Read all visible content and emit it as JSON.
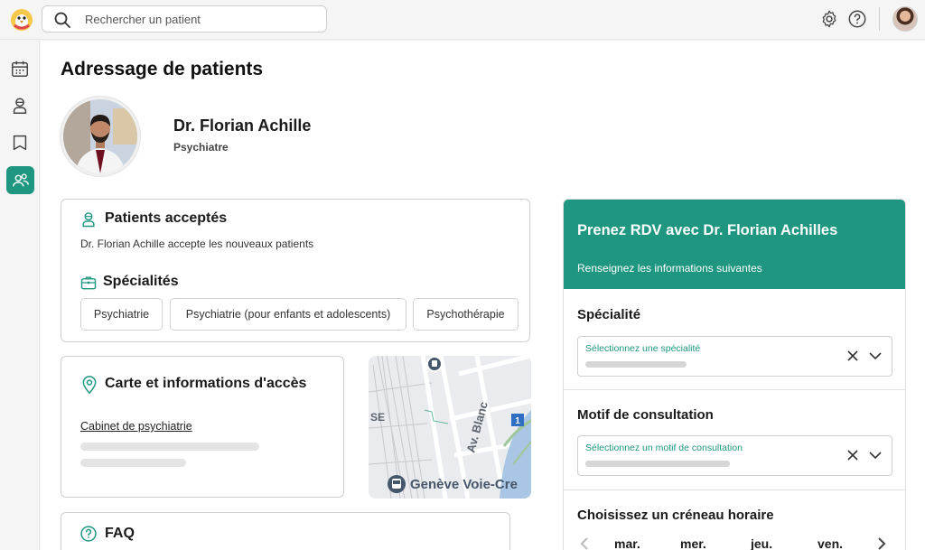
{
  "app": {
    "logo_icon": "penguin-logo",
    "accent": "#1e9680"
  },
  "search": {
    "placeholder": "Rechercher un patient"
  },
  "topbar": {
    "icons": [
      "gear-icon",
      "help-icon"
    ]
  },
  "sidebar": {
    "items": [
      {
        "icon": "calendar-icon",
        "active": false
      },
      {
        "icon": "patient-icon",
        "active": false
      },
      {
        "icon": "bookmark-icon",
        "active": false
      },
      {
        "icon": "referral-users-icon",
        "active": true
      }
    ]
  },
  "page": {
    "title": "Adressage de patients"
  },
  "doctor": {
    "name": "Dr. Florian Achille",
    "role": "Psychiatre"
  },
  "accepted": {
    "title": "Patients acceptés",
    "text": "Dr. Florian Achille accepte les nouveaux patients",
    "specialties_title": "Spécialités",
    "specialties": [
      "Psychiatrie",
      "Psychiatrie (pour enfants et adolescents)",
      "Psychothérapie"
    ]
  },
  "access": {
    "title": "Carte et informations d'accès",
    "link": "Cabinet de psychiatrie"
  },
  "map": {
    "street_label": "Av. Blanc",
    "station_label": "Genève Voie-Cre",
    "edge_label": "SE",
    "route_badge": "1"
  },
  "faq": {
    "title": "FAQ"
  },
  "booking": {
    "title": "Prenez RDV avec Dr. Florian Achilles",
    "subtitle": "Renseignez les informations suivantes",
    "specialty_title": "Spécialité",
    "specialty_placeholder": "Sélectionnez une spécialité",
    "motive_title": "Motif de consultation",
    "motive_placeholder": "Sélectionnez un motif de consultation",
    "slot_title": "Choisissez un créneau horaire",
    "days": [
      "mar.",
      "mer.",
      "jeu.",
      "ven."
    ]
  }
}
